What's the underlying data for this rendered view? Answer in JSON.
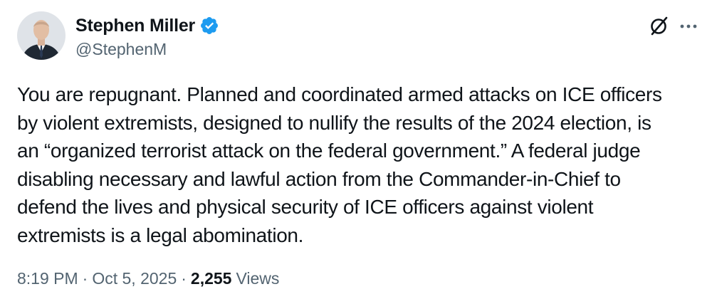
{
  "author": {
    "display_name": "Stephen Miller",
    "handle": "@StephenM",
    "verified": true,
    "verified_color": "#1d9bf0",
    "avatar_icon": "profile-photo"
  },
  "actions": {
    "grok_icon": "grok-icon",
    "more_icon": "more-icon"
  },
  "tweet": {
    "text": "You are repugnant. Planned and coordinated armed attacks on ICE officers\nby violent extremists, designed to nullify the results of the 2024 election, is\nan “organized terrorist attack on the federal government.” A federal judge\ndisabling necessary and lawful action from the Commander-in-Chief to\ndefend the lives and physical security of ICE officers against violent\nextremists is a legal abomination."
  },
  "meta": {
    "time": "8:19 PM",
    "separator": "·",
    "date": "Oct 5, 2025",
    "views_count": "2,255",
    "views_label": "Views"
  },
  "colors": {
    "text": "#0f1419",
    "secondary": "#536471",
    "accent": "#1d9bf0"
  }
}
